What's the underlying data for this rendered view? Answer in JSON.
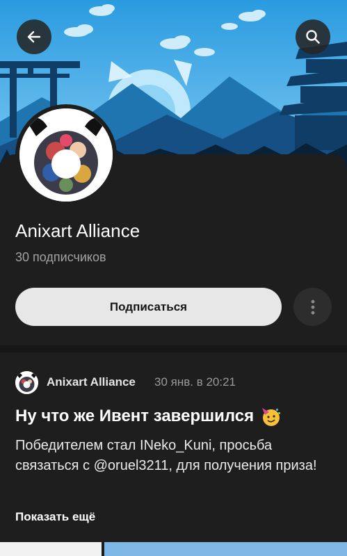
{
  "banner": {
    "alt": "banner"
  },
  "header": {
    "back_icon": "arrow-left-icon",
    "search_icon": "search-icon"
  },
  "channel": {
    "title": "Anixart Alliance",
    "subscribers": "30 подписчиков",
    "subscribe_label": "Подписаться",
    "more_icon": "vertical-dots-icon"
  },
  "post": {
    "author": "Anixart Alliance",
    "date": "30 янв. в 20:21",
    "title": "Ну что же Ивент завершился",
    "title_emoji": "partying-face-emoji",
    "body": "Победителем стал INeko_Kuni, просьба связаться с @oruel3211, для получения приза!",
    "show_more": "Показать ещё"
  },
  "colors": {
    "background": "#151515",
    "panel": "#1e1e1e",
    "button": "#e7e7e7",
    "muted_text": "#a3a3a3",
    "sky": "#3aa7e3",
    "mountain": "#1f75b0"
  }
}
